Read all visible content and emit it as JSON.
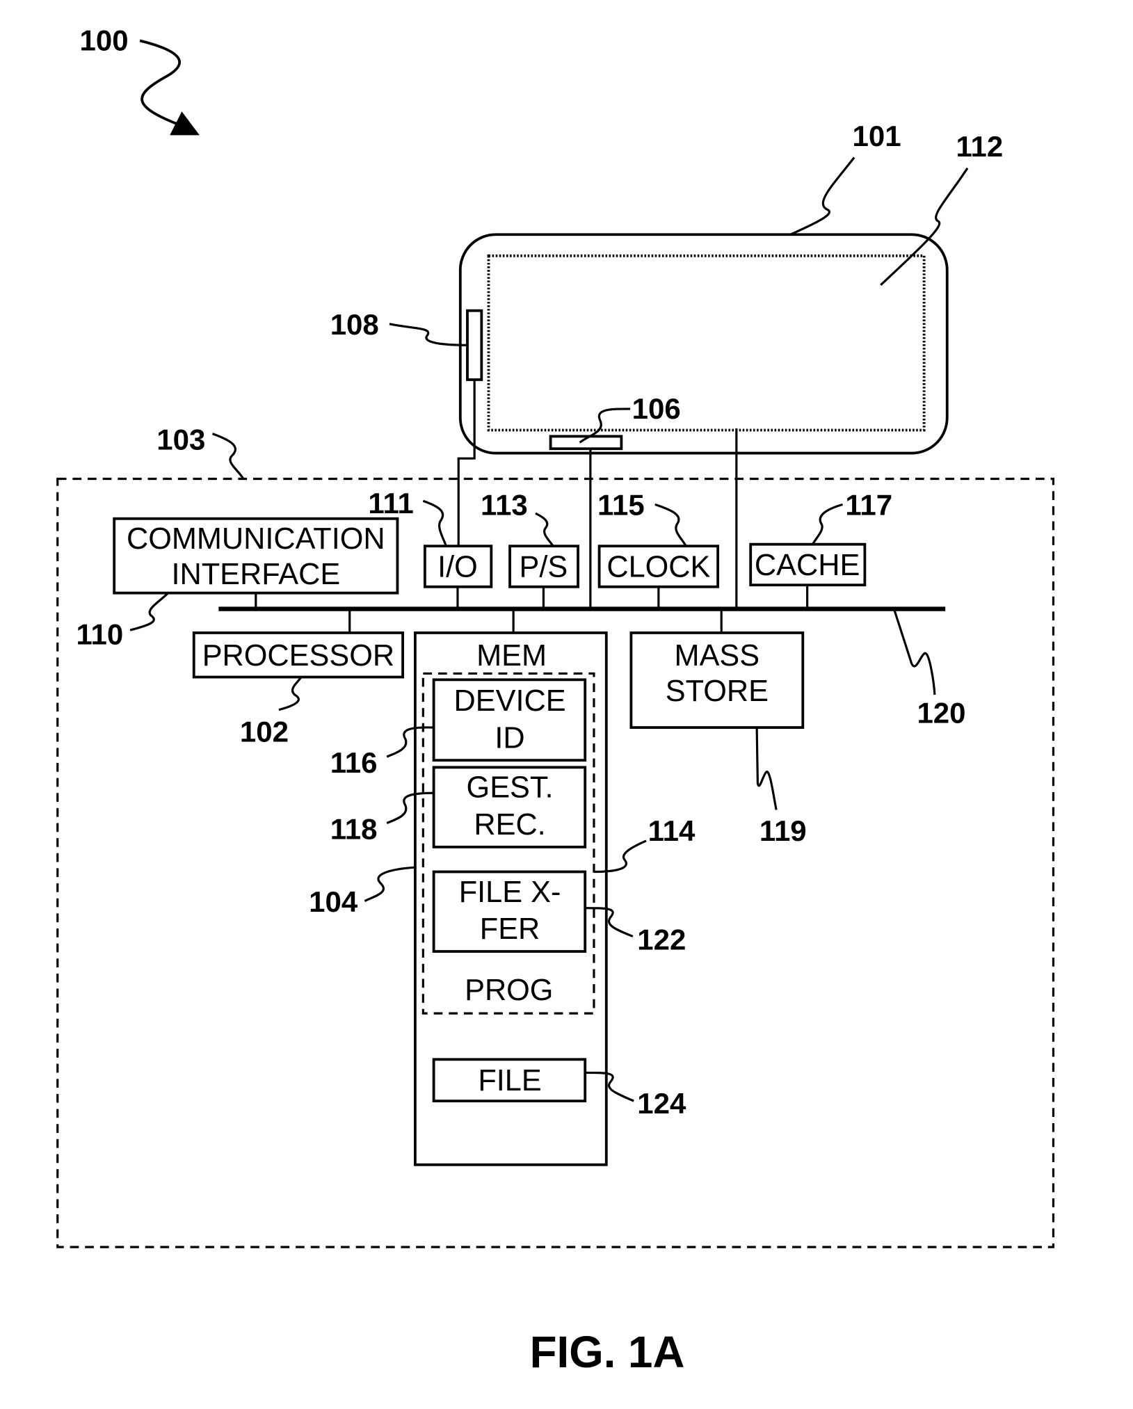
{
  "figure": {
    "caption": "FIG. 1A",
    "system_ref": "100"
  },
  "device": {
    "ref": "101",
    "display_ref": "112",
    "sensor_ref": "106",
    "side_button_ref": "108"
  },
  "computer": {
    "enclosure_ref": "103",
    "bus_ref": "120",
    "components": {
      "comm_interface": {
        "line1": "COMMUNICATION",
        "line2": "INTERFACE",
        "ref": "110"
      },
      "io": {
        "label": "I/O",
        "ref": "111"
      },
      "ps": {
        "label": "P/S",
        "ref": "113"
      },
      "clock": {
        "label": "CLOCK",
        "ref": "115"
      },
      "cache": {
        "label": "CACHE",
        "ref": "117"
      },
      "processor": {
        "label": "PROCESSOR",
        "ref": "102"
      },
      "mass_store": {
        "line1": "MASS",
        "line2": "STORE",
        "ref": "119"
      },
      "memory": {
        "label": "MEM",
        "ref": "104",
        "program": {
          "label": "PROG",
          "ref": "114",
          "modules": [
            {
              "line1": "DEVICE",
              "line2": "ID",
              "ref": "116"
            },
            {
              "line1": "GEST.",
              "line2": "REC.",
              "ref": "118"
            },
            {
              "line1": "FILE X-",
              "line2": "FER",
              "ref": "122"
            }
          ]
        },
        "file": {
          "label": "FILE",
          "ref": "124"
        }
      }
    }
  }
}
